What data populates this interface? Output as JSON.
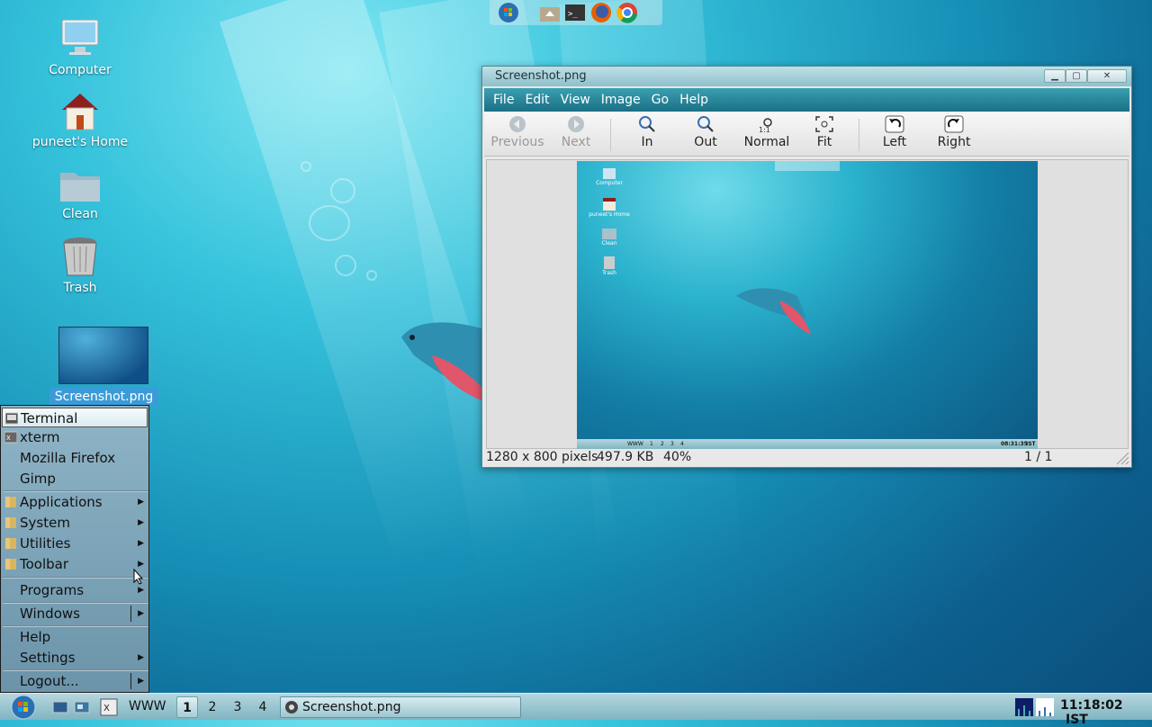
{
  "desktop": {
    "icons": [
      {
        "label": "Computer",
        "icon": "computer-icon"
      },
      {
        "label": "puneet's Home",
        "icon": "home-folder-icon"
      },
      {
        "label": "Clean",
        "icon": "folder-icon"
      },
      {
        "label": "Trash",
        "icon": "trash-icon"
      },
      {
        "label": "Screenshot.png",
        "icon": "image-file-icon"
      }
    ]
  },
  "top_dock": {
    "items": [
      "start-orb-icon",
      "home-folder-icon",
      "terminal-icon",
      "firefox-icon",
      "chrome-icon"
    ]
  },
  "viewer": {
    "title": "Screenshot.png",
    "menu": [
      "File",
      "Edit",
      "View",
      "Image",
      "Go",
      "Help"
    ],
    "toolbar": {
      "previous": "Previous",
      "next": "Next",
      "zoom_in": "In",
      "zoom_out": "Out",
      "normal": "Normal",
      "fit": "Fit",
      "rotate_left": "Left",
      "rotate_right": "Right"
    },
    "status": {
      "dimensions": "1280 x 800 pixels",
      "size": "497.9 KB",
      "zoom": "40%",
      "page": "1 / 1"
    },
    "thumbnail": {
      "icons": [
        "Computer",
        "puneet's Home",
        "Clean",
        "Trash"
      ],
      "workspace_labels": [
        "1",
        "2",
        "3",
        "4"
      ],
      "www": "WWW",
      "clock": "08:31:35",
      "tz": "IST"
    }
  },
  "menu": {
    "items": [
      {
        "label": "Terminal",
        "icon": "terminal-icon",
        "selected": true
      },
      {
        "label": "xterm",
        "icon": "xterm-icon"
      },
      {
        "label": "Mozilla Firefox"
      },
      {
        "label": "Gimp"
      },
      {
        "label": "Applications",
        "icon": "folder-icon",
        "submenu": true
      },
      {
        "label": "System",
        "icon": "folder-icon",
        "submenu": true
      },
      {
        "label": "Utilities",
        "icon": "folder-icon",
        "submenu": true
      },
      {
        "label": "Toolbar",
        "icon": "folder-icon",
        "submenu": true
      },
      {
        "label": "Programs",
        "submenu": true
      },
      {
        "label": "Windows",
        "submenu": true
      },
      {
        "label": "Help"
      },
      {
        "label": "Settings",
        "submenu": true
      },
      {
        "label": "Logout...",
        "submenu": true
      }
    ]
  },
  "taskbar": {
    "www": "WWW",
    "workspaces": [
      "1",
      "2",
      "3",
      "4"
    ],
    "active_workspace": "1",
    "task": "Screenshot.png",
    "clock": "11:18:02",
    "tz": "IST"
  }
}
